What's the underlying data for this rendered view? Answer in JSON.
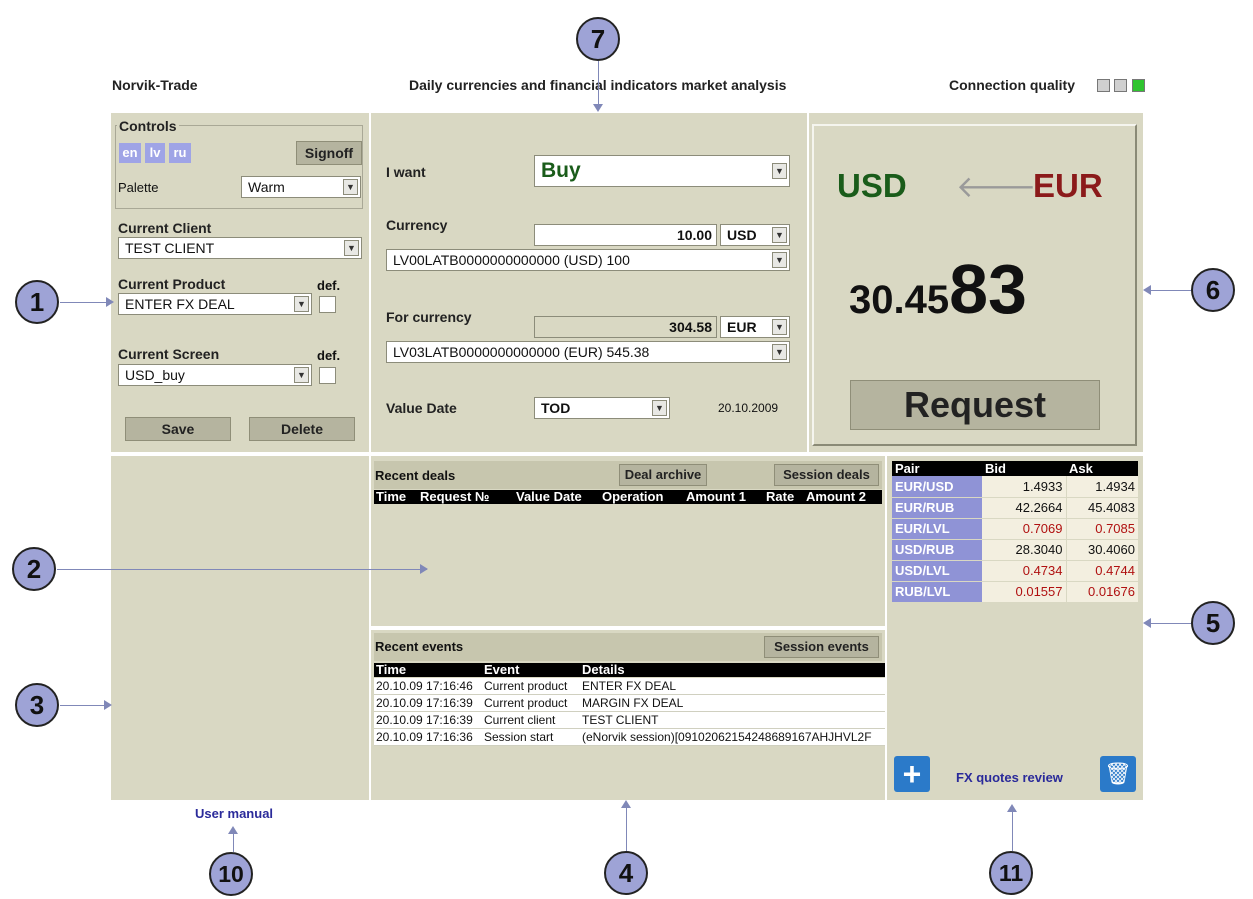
{
  "header": {
    "app_name": "Norvik-Trade",
    "subtitle": "Daily currencies and financial indicators market analysis",
    "connection_label": "Connection quality"
  },
  "controls": {
    "title": "Controls",
    "languages": [
      "en",
      "lv",
      "ru"
    ],
    "signoff": "Signoff",
    "palette_label": "Palette",
    "palette_value": "Warm"
  },
  "client": {
    "label": "Current Client",
    "value": "TEST CLIENT"
  },
  "product": {
    "label": "Current Product",
    "value": "ENTER FX DEAL",
    "def_label": "def."
  },
  "screen": {
    "label": "Current Screen",
    "value": "USD_buy",
    "def_label": "def."
  },
  "actions": {
    "save": "Save",
    "delete": "Delete"
  },
  "deal": {
    "i_want_label": "I want",
    "i_want_value": "Buy",
    "currency_label": "Currency",
    "currency_amount": "10.00",
    "currency_code": "USD",
    "currency_account": "LV00LATB0000000000000 (USD) 100",
    "for_currency_label": "For currency",
    "for_amount": "304.58",
    "for_code": "EUR",
    "for_account": "LV03LATB0000000000000 (EUR) 545.38",
    "value_date_label": "Value Date",
    "value_date_value": "TOD",
    "value_date_date": "20.10.2009"
  },
  "quote": {
    "from": "USD",
    "to": "EUR",
    "rate_small": "30.45",
    "rate_big": "83",
    "request": "Request",
    "from_color": "#1a5c1a",
    "to_color": "#8b1a1a"
  },
  "recent_deals": {
    "title": "Recent deals",
    "archive_btn": "Deal archive",
    "session_btn": "Session deals",
    "columns": [
      "Time",
      "Request №",
      "Value Date",
      "Operation",
      "Amount 1",
      "Rate",
      "Amount 2"
    ]
  },
  "recent_events": {
    "title": "Recent events",
    "session_btn": "Session events",
    "columns": [
      "Time",
      "Event",
      "Details"
    ],
    "rows": [
      [
        "20.10.09 17:16:46",
        "Current product",
        "ENTER FX DEAL"
      ],
      [
        "20.10.09 17:16:39",
        "Current product",
        "MARGIN FX DEAL"
      ],
      [
        "20.10.09 17:16:39",
        "Current client",
        "TEST CLIENT"
      ],
      [
        "20.10.09 17:16:36",
        "Session start",
        "(eNorvik session)[0910206215424868916­7AHJHVL2F"
      ]
    ]
  },
  "rates": {
    "columns": [
      "Pair",
      "Bid",
      "Ask"
    ],
    "rows": [
      {
        "pair": "EUR/USD",
        "bid": "1.4933",
        "ask": "1.4934",
        "red": false
      },
      {
        "pair": "EUR/RUB",
        "bid": "42.2664",
        "ask": "45.4083",
        "red": false
      },
      {
        "pair": "EUR/LVL",
        "bid": "0.7069",
        "ask": "0.7085",
        "red": true
      },
      {
        "pair": "USD/RUB",
        "bid": "28.3040",
        "ask": "30.4060",
        "red": false
      },
      {
        "pair": "USD/LVL",
        "bid": "0.4734",
        "ask": "0.4744",
        "red": true
      },
      {
        "pair": "RUB/LVL",
        "bid": "0.01557",
        "ask": "0.01676",
        "red": true
      }
    ]
  },
  "footer": {
    "user_manual": "User manual",
    "fx_review": "FX quotes review"
  },
  "callouts": [
    "1",
    "2",
    "3",
    "4",
    "5",
    "6",
    "7",
    "10",
    "11"
  ]
}
